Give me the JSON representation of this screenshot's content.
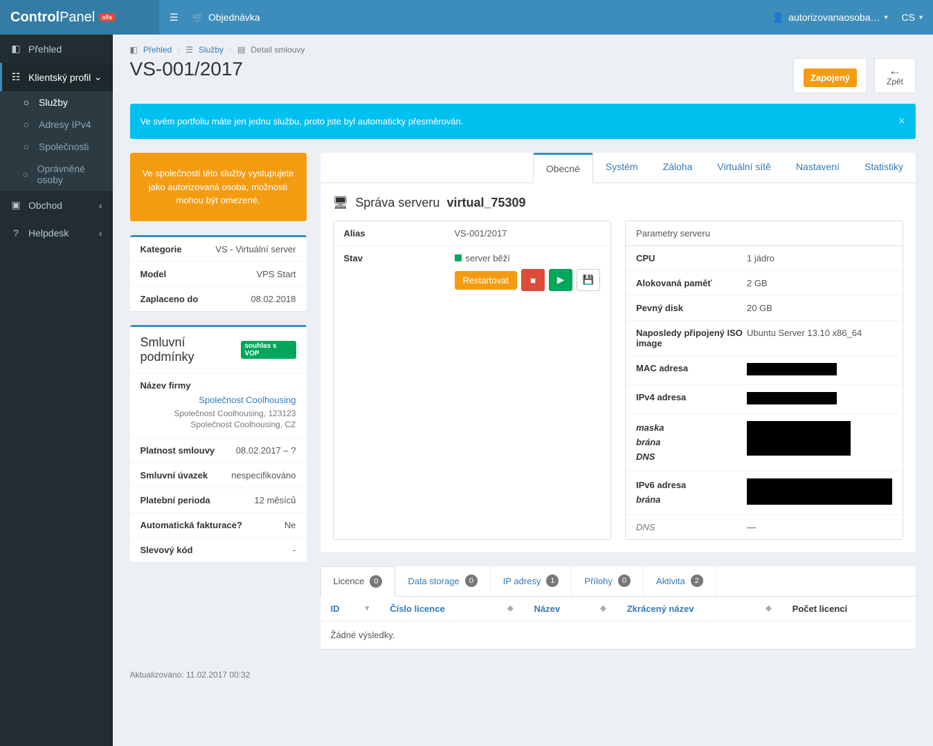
{
  "brand": {
    "name1": "Control",
    "name2": "Panel",
    "badge": "alfa"
  },
  "topnav": {
    "order": "Objednávka",
    "user": "autorizovanaosoba…",
    "lang": "CS"
  },
  "sidebar": {
    "overview": "Přehled",
    "profile": "Klientský profil",
    "sub": {
      "services": "Služby",
      "ipv4": "Adresy IPv4",
      "companies": "Společnosti",
      "persons": "Oprávněné osoby"
    },
    "shop": "Obchod",
    "helpdesk": "Helpdesk"
  },
  "breadcrumb": {
    "a": "Přehled",
    "b": "Služby",
    "c": "Detail smlouvy"
  },
  "page_title": "VS-001/2017",
  "status_badge": "Zapojený",
  "back_label": "Zpět",
  "alert": "Ve svém portfoliu máte jen jednu službu, proto jste byl automaticky přesměrován.",
  "warn_box": "Ve společnosti této služby vystupujete jako autorizovaná osoba, možnosti mohou být omezené.",
  "cat_panel": {
    "category_l": "Kategorie",
    "category_v": "VS - Virtuální server",
    "model_l": "Model",
    "model_v": "VPS Start",
    "paid_l": "Zaplaceno do",
    "paid_v": "08.02.2018"
  },
  "contract": {
    "title": "Smluvní podmínky",
    "vop": "souhlas s VOP",
    "company_l": "Název firmy",
    "company_link": "Společnost Coolhousing",
    "company_addr": "Společnost Coolhousing, 123123 Společnost Coolhousing, CZ",
    "validity_l": "Platnost smlouvy",
    "validity_v": "08.02.2017 – ?",
    "term_l": "Smluvní úvazek",
    "term_v": "nespecifikováno",
    "period_l": "Platební perioda",
    "period_v": "12 měsíců",
    "autoinv_l": "Automatická fakturace?",
    "autoinv_v": "Ne",
    "discount_l": "Slevový kód",
    "discount_v": "-"
  },
  "tabs": {
    "general": "Obecné",
    "system": "Systém",
    "backup": "Záloha",
    "vnet": "Virtuální sítě",
    "settings": "Nastavení",
    "stats": "Statistiky"
  },
  "server": {
    "title_prefix": "Správa serveru",
    "name": "virtual_75309",
    "alias_l": "Alias",
    "alias_v": "VS-001/2017",
    "state_l": "Stav",
    "state_v": "server běží",
    "restart": "Restartovat",
    "params_title": "Parametry serveru",
    "cpu_l": "CPU",
    "cpu_v": "1 jádro",
    "mem_l": "Alokovaná paměť",
    "mem_v": "2 GB",
    "disk_l": "Pevný disk",
    "disk_v": "20 GB",
    "iso_l": "Naposledy připojený ISO image",
    "iso_v": "Ubuntu Server 13.10 x86_64",
    "mac_l": "MAC adresa",
    "ipv4_l": "IPv4 adresa",
    "mask_l": "maska",
    "gw_l": "brána",
    "dns_l": "DNS",
    "ipv6_l": "IPv6 adresa",
    "ipv6_dns_v": "—"
  },
  "ltabs": {
    "licence": "Licence",
    "licence_n": "0",
    "storage": "Data storage",
    "storage_n": "0",
    "ip": "IP adresy",
    "ip_n": "1",
    "attach": "Přílohy",
    "attach_n": "0",
    "activity": "Aktivita",
    "activity_n": "2"
  },
  "ltable": {
    "id": "ID",
    "num": "Číslo licence",
    "name": "Název",
    "short": "Zkrácený název",
    "count": "Počet licencí",
    "empty": "Žádné výsledky."
  },
  "footer": "Aktualizováno: 11.02.2017 00:32"
}
